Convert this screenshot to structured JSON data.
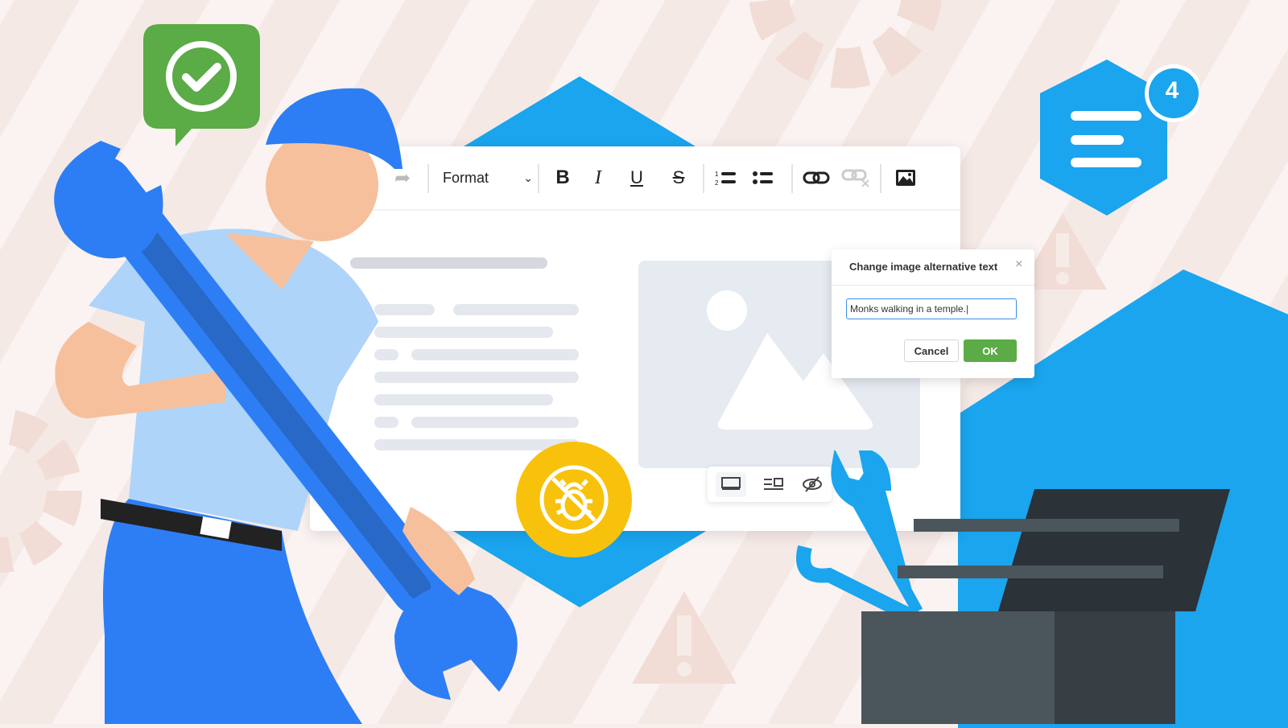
{
  "toolbar": {
    "format_label": "Format",
    "items": [
      "redo-icon",
      "format-dropdown",
      "bold-icon",
      "italic-icon",
      "underline-icon",
      "strikethrough-icon",
      "numbered-list-icon",
      "bullet-list-icon",
      "link-icon",
      "unlink-icon",
      "image-icon"
    ]
  },
  "dialog": {
    "title": "Change image alternative text",
    "input_value": "Monks walking in a temple.",
    "cancel_label": "Cancel",
    "ok_label": "OK"
  },
  "image_toolbar": {
    "items": [
      "full-width-icon",
      "text-wrap-icon",
      "hide-icon"
    ]
  },
  "notification": {
    "count": "4"
  },
  "colors": {
    "accent_blue": "#1aa5ee",
    "ok_green": "#5bab46",
    "bug_yellow": "#f8c20c",
    "worker_blue": "#2d7ef4"
  }
}
